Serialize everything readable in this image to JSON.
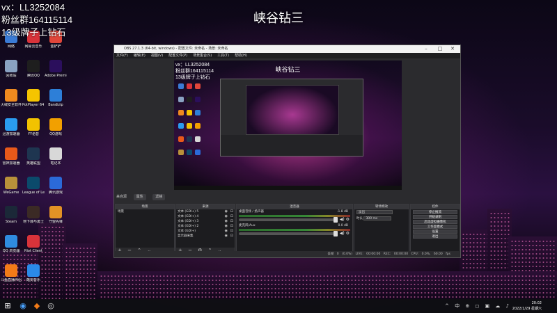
{
  "overlay": {
    "line1": "vx：LL3252084",
    "line2": "粉丝群164115114",
    "line3": "13级牌子上钻石"
  },
  "stream_title": "峡谷钻三",
  "desktop_icons": [
    {
      "label": "网络",
      "color": "#3a7bd5"
    },
    {
      "label": "网易云音乐",
      "color": "#d8333a"
    },
    {
      "label": "金铲铲",
      "color": "#e0463a"
    },
    {
      "label": "回收站",
      "color": "#8aa2c2"
    },
    {
      "label": "腾讯QQ",
      "color": "#1e1e1e"
    },
    {
      "label": "Adobe Premie...",
      "color": "#2b0f5c"
    },
    {
      "label": "火绒安全软件",
      "color": "#ef8a1f"
    },
    {
      "label": "PotPlayer 64 bit",
      "color": "#f5c400"
    },
    {
      "label": "Bandizip",
      "color": "#2d7fd8"
    },
    {
      "label": "迅游加速器",
      "color": "#2a9cf0"
    },
    {
      "label": "YY语音",
      "color": "#f2c200"
    },
    {
      "label": "QQ游戏",
      "color": "#f2a000"
    },
    {
      "label": "雷神加速器",
      "color": "#e8591a"
    },
    {
      "label": "英雄联盟",
      "color": "#1e3550"
    },
    {
      "label": "笔记本",
      "color": "#d8d8d8"
    },
    {
      "label": "WeGame",
      "color": "#b8913a"
    },
    {
      "label": "League of Legends",
      "color": "#0b4a6b"
    },
    {
      "label": "腾讯游戏",
      "color": "#2b6ad8"
    },
    {
      "label": "Steam",
      "color": "#1b2838"
    },
    {
      "label": "地下城与勇士",
      "color": "#3b2a25"
    },
    {
      "label": "守望先锋",
      "color": "#e39225"
    },
    {
      "label": "QQ 浏览器",
      "color": "#2f8ce0"
    },
    {
      "label": "Riot Client",
      "color": "#d8333a"
    },
    {
      "label": "",
      "color": "#00000000"
    },
    {
      "label": "斗鱼直播伴侣",
      "color": "#f27b18"
    },
    {
      "label": "酷狗音乐",
      "color": "#2a8ae8"
    }
  ],
  "obs": {
    "title": "OBS 27.1.3 (64-bit, windows) - 配置文件: 未命名 - 场景: 未命名",
    "menu": [
      "文件(F)",
      "编辑(E)",
      "视图(V)",
      "配置文件(P)",
      "场景集合(S)",
      "工具(T)",
      "帮助(H)"
    ],
    "scene_tabs": [
      "来自源",
      "属性",
      "滤镜"
    ],
    "docks": {
      "scenes": {
        "title": "场景",
        "items": [
          "场景"
        ]
      },
      "sources": {
        "title": "来源",
        "items": [
          "文本 (GDI+) 5",
          "文本 (GDI+) 4",
          "文本 (GDI+) 3",
          "文本 (GDI+) 2",
          "文本 (GDI+)",
          "显示器采集"
        ]
      },
      "mixer": {
        "title": "混音器",
        "channels": [
          {
            "name": "桌面音频 / 扬声器",
            "db": "-1.8 dB"
          },
          {
            "name": "麦克风/Aux",
            "db": "0.0 dB"
          }
        ]
      },
      "transitions": {
        "title": "转场特效",
        "type": "淡出",
        "duration_label": "时长",
        "duration": "300 ms"
      },
      "controls": {
        "title": "控件",
        "buttons": [
          "停止推流",
          "开始录制",
          "启动虚拟摄像机",
          "工作室模式",
          "设置",
          "退出"
        ]
      }
    },
    "status": "丢帧 0 (0.0%)   LIVE: 00:00:00   REC: 00:00:00   CPU: 0.0%, 60.00 fps"
  },
  "taskbar": {
    "start_icon": "windows-icon",
    "tray": "^ 中 ⊕ ◻ ▣ ☁ ♪",
    "time": "20:02",
    "date": "2022/1/29 星期六"
  }
}
